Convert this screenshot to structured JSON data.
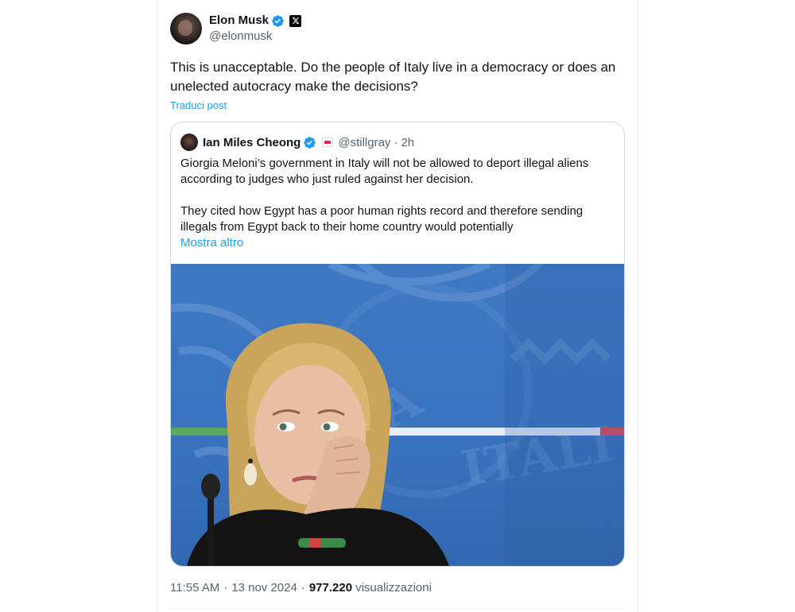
{
  "tweet": {
    "author_name": "Elon Musk",
    "author_handle": "@elonmusk",
    "text": "This is unacceptable. Do the people of Italy live in a democracy or does an unelected autocracy make the decisions?",
    "translate_label": "Traduci post",
    "time": "11:55 AM",
    "date": "13 nov 2024",
    "separator": "·",
    "views_count": "977.220",
    "views_label": "visualizzazioni"
  },
  "quote": {
    "author_name": "Ian Miles Cheong",
    "author_handle": "@stillgray",
    "separator": "·",
    "time_ago": "2h",
    "paragraph_1": "Giorgia Meloni’s government in Italy will not be allowed to deport illegal aliens according to judges who just ruled against her decision.",
    "paragraph_2": "They cited how Egypt has a poor human rights record and therefore sending illegals from Egypt back to their home country would potentially",
    "show_more_label": "Mostra altro"
  },
  "icons": {
    "verified": "verified-badge-icon",
    "x_affiliation": "x-logo-icon",
    "quote_affiliation": "affiliation-badge-icon"
  },
  "colors": {
    "accent": "#1d9bf0",
    "text_primary": "#0f1419",
    "text_secondary": "#536471",
    "border": "#cfd9de",
    "image_background": "#3f79c4"
  }
}
